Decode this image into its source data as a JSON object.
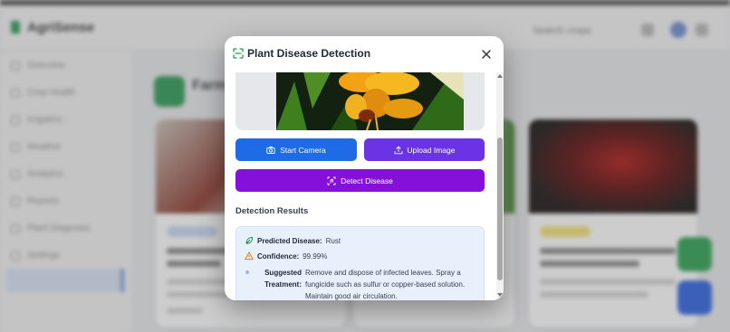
{
  "background": {
    "brand": "AgriSense",
    "header_search": "Search crops",
    "page_title": "Farm",
    "sidebar_items": [
      "Overview",
      "Crop Health",
      "Irrigation",
      "Weather",
      "Analytics",
      "Reports",
      "Plant Diagnosis",
      "Settings"
    ]
  },
  "modal": {
    "title": "Plant Disease Detection",
    "buttons": {
      "camera": "Start Camera",
      "upload": "Upload Image",
      "detect": "Detect Disease"
    },
    "results": {
      "heading": "Detection Results",
      "disease_label": "Predicted Disease:",
      "disease_value": "Rust",
      "confidence_label": "Confidence:",
      "confidence_value": "99.99%",
      "treatment_label": "Suggested Treatment:",
      "treatment_value": "Remove and dispose of infected leaves. Spray a fungicide such as sulfur or copper-based solution. Maintain good air circulation."
    }
  },
  "colors": {
    "camera_button": "#1e6be6",
    "upload_button": "#6a34e4",
    "detect_button": "#8410d9",
    "results_bg": "#e7f0fb",
    "accent_green": "#2f9a57"
  },
  "icons": {
    "header": "scan-icon",
    "close": "close-icon",
    "camera": "camera-icon",
    "upload": "upload-icon",
    "detect": "scan-hand-icon",
    "disease": "leaf-icon",
    "confidence": "warning-triangle-icon"
  }
}
